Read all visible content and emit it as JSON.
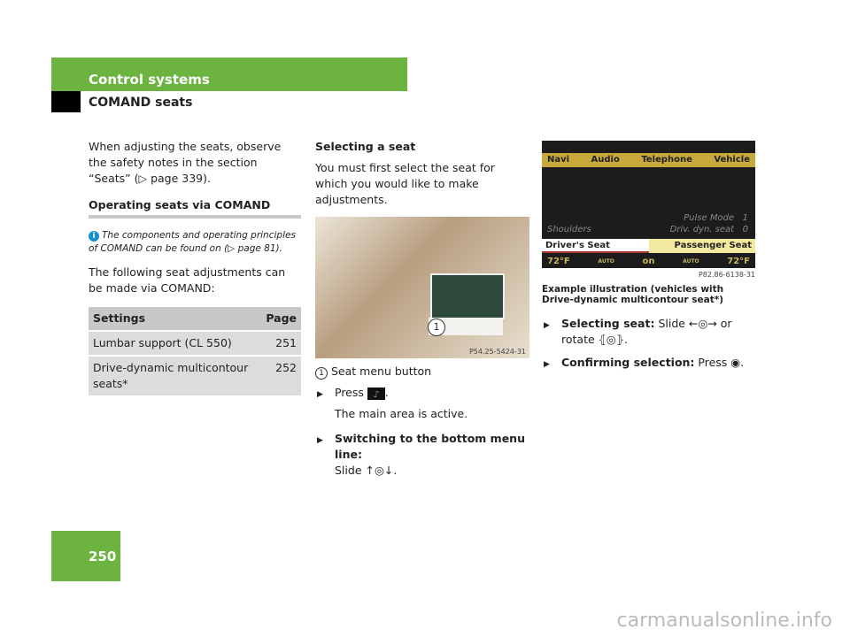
{
  "header": {
    "section": "Control systems",
    "subsection": "COMAND seats",
    "page_number": "250"
  },
  "col1": {
    "intro": "When adjusting the seats, observe the safety notes in the section “Seats” (▷ page 339).",
    "heading": "Operating seats via COMAND",
    "note": "The components and operating principles of COMAND can be found on (▷ page 81).",
    "para": "The following seat adjustments can be made via COMAND:",
    "table": {
      "headers": [
        "Settings",
        "Page"
      ],
      "rows": [
        [
          "Lumbar support (CL 550)",
          "251"
        ],
        [
          "Drive-dynamic multicontour seats*",
          "252"
        ]
      ]
    }
  },
  "col2": {
    "heading": "Selecting a seat",
    "para": "You must first select the seat for which you would like to make adjustments.",
    "image_code": "P54.25-5424-31",
    "callout_num": "1",
    "legend": "Seat menu button",
    "step1": "Press",
    "step1_result": "The main area is active.",
    "step2_bold": "Switching to the bottom menu line:",
    "step2_text": "Slide ↑◎↓."
  },
  "col3": {
    "screen": {
      "menu": [
        "Navi",
        "Audio",
        "Telephone",
        "Vehicle"
      ],
      "shoulders": "Shoulders",
      "pulse_mode": "Pulse Mode",
      "pulse_val": "1",
      "driv_dyn": "Driv. dyn. seat",
      "driv_val": "0",
      "driver_seat": "Driver's Seat",
      "passenger_seat": "Passenger Seat",
      "temp_left": "72°F",
      "temp_right": "72°F",
      "on": "on",
      "auto": "AUTO"
    },
    "image_code": "P82.86-6138-31",
    "caption": "Example illustration (vehicles with Drive-dynamic multicontour seat*)",
    "step1_bold": "Selecting seat:",
    "step1_text": "Slide ←◎→ or rotate ⦃◎⦄.",
    "step2_bold": "Confirming selection:",
    "step2_text": "Press ◉."
  },
  "watermark": "carmanualsonline.info"
}
